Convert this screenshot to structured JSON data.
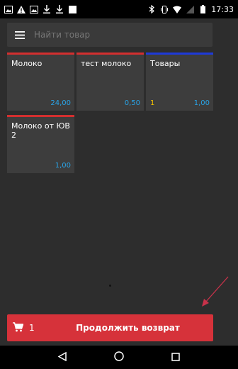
{
  "status_bar": {
    "time": "17:33",
    "left_icons": [
      "image-icon",
      "warning-icon",
      "image-icon",
      "download-icon",
      "download-icon",
      "square-icon"
    ],
    "right_icons": [
      "bluetooth-icon",
      "vibrate-icon",
      "wifi-icon",
      "signal-icon",
      "battery-icon"
    ]
  },
  "search": {
    "placeholder": "Найти товар"
  },
  "products": [
    {
      "name": "Молоко",
      "price": "24,00",
      "count": "",
      "accent": "#d32f2f"
    },
    {
      "name": "тест молоко",
      "price": "0,50",
      "count": "",
      "accent": "#d32f2f"
    },
    {
      "name": "Товары",
      "price": "1,00",
      "count": "1",
      "accent": "#1e3ad8"
    },
    {
      "name": "Молоко от ЮВ 2",
      "price": "1,00",
      "count": "",
      "accent": "#d32f2f"
    }
  ],
  "bottom": {
    "cart_count": "1",
    "continue_label": "Продолжить возврат"
  },
  "colors": {
    "background": "#2d2d2d",
    "accent_red": "#d6323a",
    "price_blue": "#29a3e6",
    "count_yellow": "#f2c200"
  }
}
